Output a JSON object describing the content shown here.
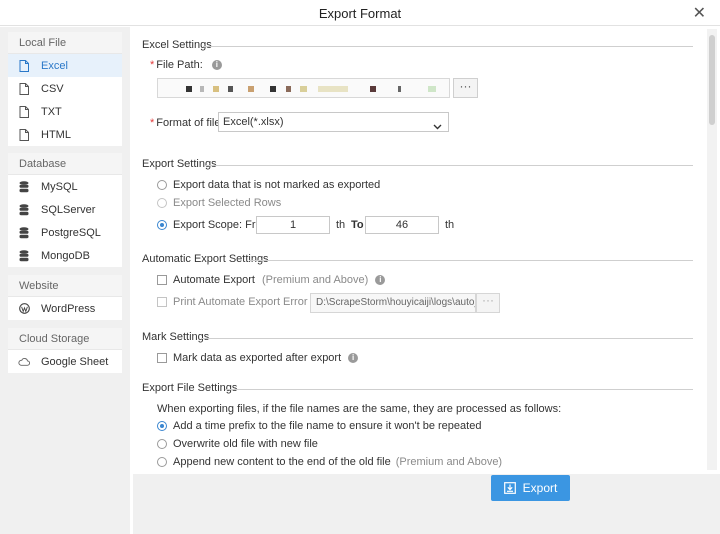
{
  "window": {
    "title": "Export Format",
    "close_glyph": "✕"
  },
  "sidebar": {
    "groups": [
      {
        "header": "Local File",
        "items": [
          {
            "label": "Excel",
            "icon": "file-icon",
            "active": true
          },
          {
            "label": "CSV",
            "icon": "file-icon"
          },
          {
            "label": "TXT",
            "icon": "file-icon"
          },
          {
            "label": "HTML",
            "icon": "file-icon"
          }
        ]
      },
      {
        "header": "Database",
        "items": [
          {
            "label": "MySQL",
            "icon": "database-icon"
          },
          {
            "label": "SQLServer",
            "icon": "database-icon"
          },
          {
            "label": "PostgreSQL",
            "icon": "database-icon"
          },
          {
            "label": "MongoDB",
            "icon": "database-icon"
          }
        ]
      },
      {
        "header": "Website",
        "items": [
          {
            "label": "WordPress",
            "icon": "wordpress-icon"
          }
        ]
      },
      {
        "header": "Cloud Storage",
        "items": [
          {
            "label": "Google Sheet",
            "icon": "cloud-icon"
          }
        ]
      }
    ]
  },
  "excel_settings": {
    "title": "Excel Settings",
    "file_path_label": "File Path:",
    "browse_label": "···",
    "format_label": "Format of file:",
    "format_value": "Excel(*.xlsx)"
  },
  "export_settings": {
    "title": "Export Settings",
    "option_unexported": "Export data that is not marked as exported",
    "option_selected_rows": "Export Selected Rows",
    "option_scope": "Export Scope: From",
    "scope_from": "1",
    "scope_th": "th",
    "scope_to_label": "To",
    "scope_to": "46",
    "scope_th2": "th",
    "selected": "scope"
  },
  "automatic_export": {
    "title": "Automatic Export Settings",
    "automate_label": "Automate Export",
    "automate_note": "(Premium and Above)",
    "print_log_label": "Print Automate Export Error Log",
    "log_path": "D:\\ScrapeStorm\\houyicaiji\\logs\\auto_e",
    "log_browse": "···"
  },
  "mark_settings": {
    "title": "Mark Settings",
    "mark_label": "Mark data as exported after export"
  },
  "file_settings": {
    "title": "Export File Settings",
    "description": "When exporting files, if the file names are the same, they are processed as follows:",
    "option_prefix": "Add a time prefix to the file name to ensure it won't be repeated",
    "option_overwrite": "Overwrite old file with new file",
    "option_append": "Append new content to the end of the old file",
    "append_note": "(Premium and Above)",
    "selected": "prefix"
  },
  "footer": {
    "export_label": "Export"
  },
  "colors": {
    "accent": "#3b96e2",
    "active_bg": "#e7f1fb",
    "sidebar_bg": "#f0f0f0",
    "required": "#e23a3a"
  }
}
